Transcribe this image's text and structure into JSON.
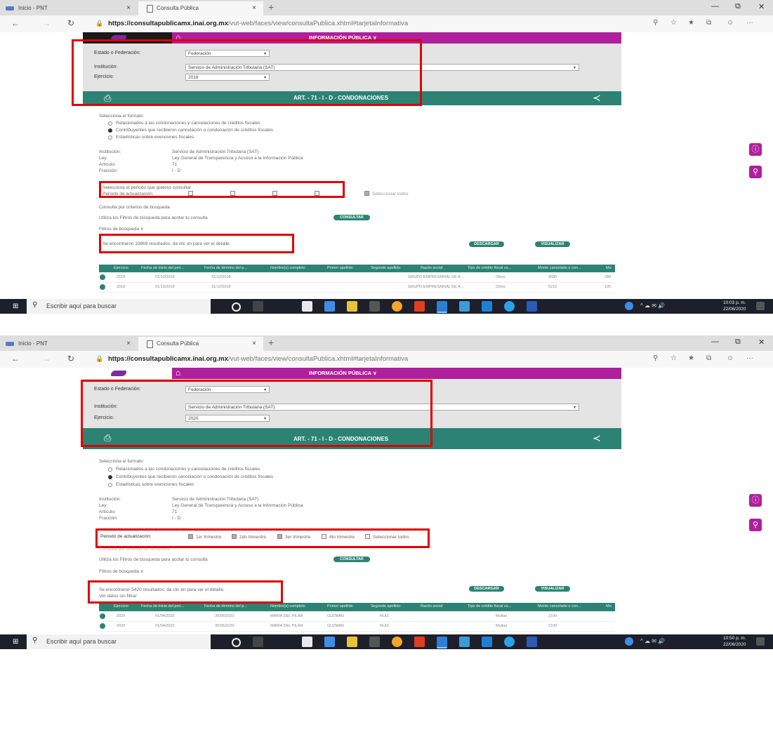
{
  "browser": {
    "tabs": [
      {
        "label": "Inicio - PNT"
      },
      {
        "label": "Consulta Pública"
      }
    ],
    "new_tab": "+",
    "tab_close": "×",
    "window_controls": [
      "—",
      "⧉",
      "✕"
    ],
    "nav": {
      "back": "←",
      "forward": "→",
      "reload": "↻",
      "lock": "🔒"
    },
    "url_host": "https://consultapublicamx.inai.org.mx",
    "url_path": "/vut-web/faces/view/consultaPublica.xhtml#tarjetaInformativa"
  },
  "header": {
    "title": "INFORMACIÓN PÚBLICA ∨"
  },
  "filters": {
    "estado_label": "Estado o Federación:",
    "estado_value": "Federación",
    "institucion_label": "Institución:",
    "institucion_value": "Servicio de Administración Tributaria (SAT)",
    "ejercicio_label": "Ejercicio:",
    "ejercicio_value_1": "2018",
    "ejercicio_value_2": "2020",
    "caret": "▾"
  },
  "section": {
    "title": "ART. - 71 - I - D - CONDONACIONES"
  },
  "formato": {
    "heading": "Selecciona el formato:",
    "options": [
      "Relacionados a las condonaciones y cancelaciones de créditos fiscales",
      "Contribuyentes que recibieron cancelación o condonación de créditos fiscales",
      "Estadísticas sobre exenciones fiscales"
    ]
  },
  "info": {
    "labels": [
      "Institución:",
      "Ley:",
      "Artículo:",
      "Fracción:"
    ],
    "values": [
      "Servicio de Administración Tributaria (SAT)",
      "Ley General de Transparencia y Acceso a la Información Pública",
      "71",
      "I - D"
    ]
  },
  "periodo": {
    "hint": "Selecciona el periodo que quieres consultar",
    "label": "Periodo de actualización:",
    "options": [
      "1er trimestre",
      "2do trimestre",
      "3er trimestre",
      "4to trimestre",
      "Seleccionar todos"
    ]
  },
  "consulta": {
    "note": "Consulta por criterios de búsqueda",
    "utiliza": "Utiliza los Filtros de búsqueda para acotar tu consulta",
    "button": "CONSULTAR",
    "filtros": "Filtros de búsqueda ∨"
  },
  "results": {
    "text_1": "Se encontraron 19869 resultados, da clic en  para ver el detalle.",
    "text_2": "Se encontraron 5420 resultados, da clic en  para ver el detalle.",
    "ver_datos": "Ver datos sin filtrar",
    "descargar": "DESCARGAR",
    "visualizar": "VISUALIZAR"
  },
  "table": {
    "headers": [
      "Ejercicio",
      "Fecha de inicio del peri...",
      "Fecha de término del p...",
      "Nombre(s) completo",
      "Primer apellido",
      "Segundo apellido",
      "Razón social",
      "Tipo de crédito fiscal co...",
      "Monto cancelado o con...",
      "Mo"
    ],
    "rows_1": [
      [
        "2018",
        "01/10/2018",
        "31/12/2018",
        "",
        "",
        "",
        "GRUPO EMPRESARIAL DE A...",
        "Otros",
        "9580",
        "398"
      ],
      [
        "2018",
        "01/10/2018",
        "31/12/2018",
        "",
        "",
        "",
        "GRUPO EMPRESARIAL DE A...",
        "Otros",
        "5210",
        "105"
      ]
    ],
    "rows_2": [
      [
        "2020",
        "01/04/2020",
        "30/06/2020",
        "MARIA DEL PILAR",
        "GUZMAN",
        "RUIZ",
        "",
        "Multas",
        "2100",
        ""
      ],
      [
        "2020",
        "01/04/2020",
        "30/06/2020",
        "MARIA DEL PILAR",
        "GUZMAN",
        "RUIZ",
        "",
        "Multas",
        "2100",
        ""
      ]
    ]
  },
  "taskbar": {
    "search_placeholder": "Escribir aquí para buscar",
    "time_1": "10:03 p. m.",
    "time_2": "10:50 p. m.",
    "date": "22/06/2020",
    "tray": "^ ☁ ✉ 🔊"
  },
  "colors": {
    "magenta": "#b01f9c",
    "teal": "#2c8373",
    "highlight": "#e00000"
  }
}
